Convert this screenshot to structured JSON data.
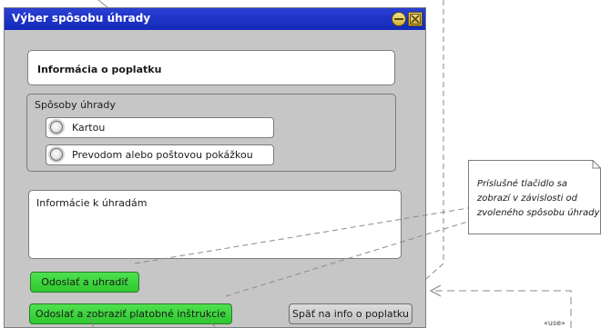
{
  "window": {
    "title": "Výber spôsobu úhrady",
    "controls": {
      "minimize_icon": "minimize-icon",
      "close_icon": "close-icon"
    }
  },
  "fee_info": {
    "label": "Informácia o poplatku"
  },
  "payment_methods": {
    "label": "Spôsoby úhrady",
    "options": [
      {
        "label": "Kartou",
        "selected": false
      },
      {
        "label": "Prevodom alebo poštovou pokážkou",
        "selected": false
      }
    ]
  },
  "payment_info": {
    "label": "Informácie k úhradám"
  },
  "buttons": {
    "pay": "Odoslať a uhradiť",
    "send_instructions": "Odoslať a zobraziť platobné inštrukcie",
    "back": "Späť na info o poplatku"
  },
  "note": {
    "lines": [
      "Príslušné tlačidlo sa",
      "zobrazí v závislosti od",
      "zvoleného spôsobu úhrady"
    ]
  },
  "stereotype_label": "«use»",
  "colors": {
    "titlebar": "#1a30c8",
    "window_bg": "#c6c6c6",
    "primary_button": "#3ad63a",
    "secondary_button": "#cfcfcf",
    "connector": "#8a8a8a"
  }
}
